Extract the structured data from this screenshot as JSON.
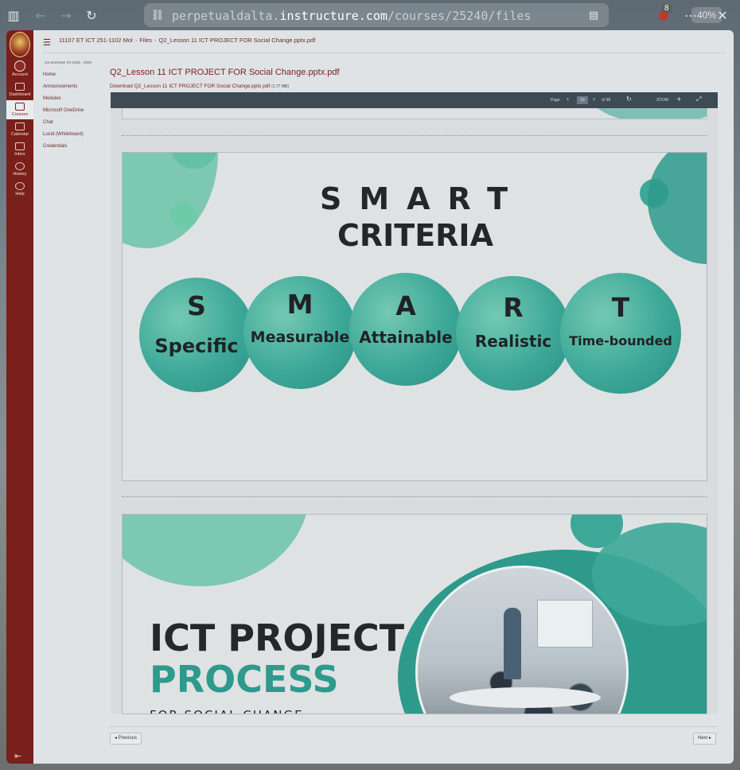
{
  "browser": {
    "url_prefix": "perpetualdalta.",
    "url_host": "instructure.com",
    "url_path": "/courses/25240/files",
    "zoom": "40%",
    "extension_badge": "8"
  },
  "global_nav": {
    "items": [
      {
        "label": "Account"
      },
      {
        "label": "Dashboard"
      },
      {
        "label": "Courses"
      },
      {
        "label": "Calendar"
      },
      {
        "label": "Inbox"
      },
      {
        "label": "History"
      },
      {
        "label": "Help"
      }
    ]
  },
  "breadcrumb": {
    "course": "11107 ET ICT 251-1102 Mol",
    "section": "Files",
    "file": "Q2_Lesson 11 ICT PROJECT FOR Social Change.pptx.pdf"
  },
  "course_nav": {
    "term": "1st Semester SY 2025 - 2026",
    "links": [
      "Home",
      "Announcements",
      "Modules",
      "Microsoft OneDrive",
      "Chat",
      "Lucid (Whiteboard)",
      "Credentials"
    ]
  },
  "file": {
    "title": "Q2_Lesson 11 ICT PROJECT FOR Social Change.pptx.pdf",
    "download_label": "Download Q2_Lesson 11 ICT PROJECT FOR Social Change.pptx.pdf",
    "size": "(1.77 MB)"
  },
  "viewer": {
    "page_label": "Page",
    "current_page": "19",
    "page_total": "of 38",
    "zoom_label": "ZOOM"
  },
  "slide_smart": {
    "title_word": "SMART",
    "subtitle": "CRITERIA",
    "circles": [
      {
        "letter": "S",
        "word": "Specific"
      },
      {
        "letter": "M",
        "word": "Measurable"
      },
      {
        "letter": "A",
        "word": "Attainable"
      },
      {
        "letter": "R",
        "word": "Realistic"
      },
      {
        "letter": "T",
        "word": "Time-bounded"
      }
    ]
  },
  "slide_process": {
    "line1": "ICT PROJECT",
    "line2": "PROCESS",
    "line3": "FOR SOCIAL CHANGE"
  },
  "footer": {
    "previous": "◂ Previous",
    "next": "Next ▸"
  },
  "colors": {
    "brand": "#7a1f1a",
    "teal": "#3da898",
    "toolbar": "#3e4a54"
  }
}
